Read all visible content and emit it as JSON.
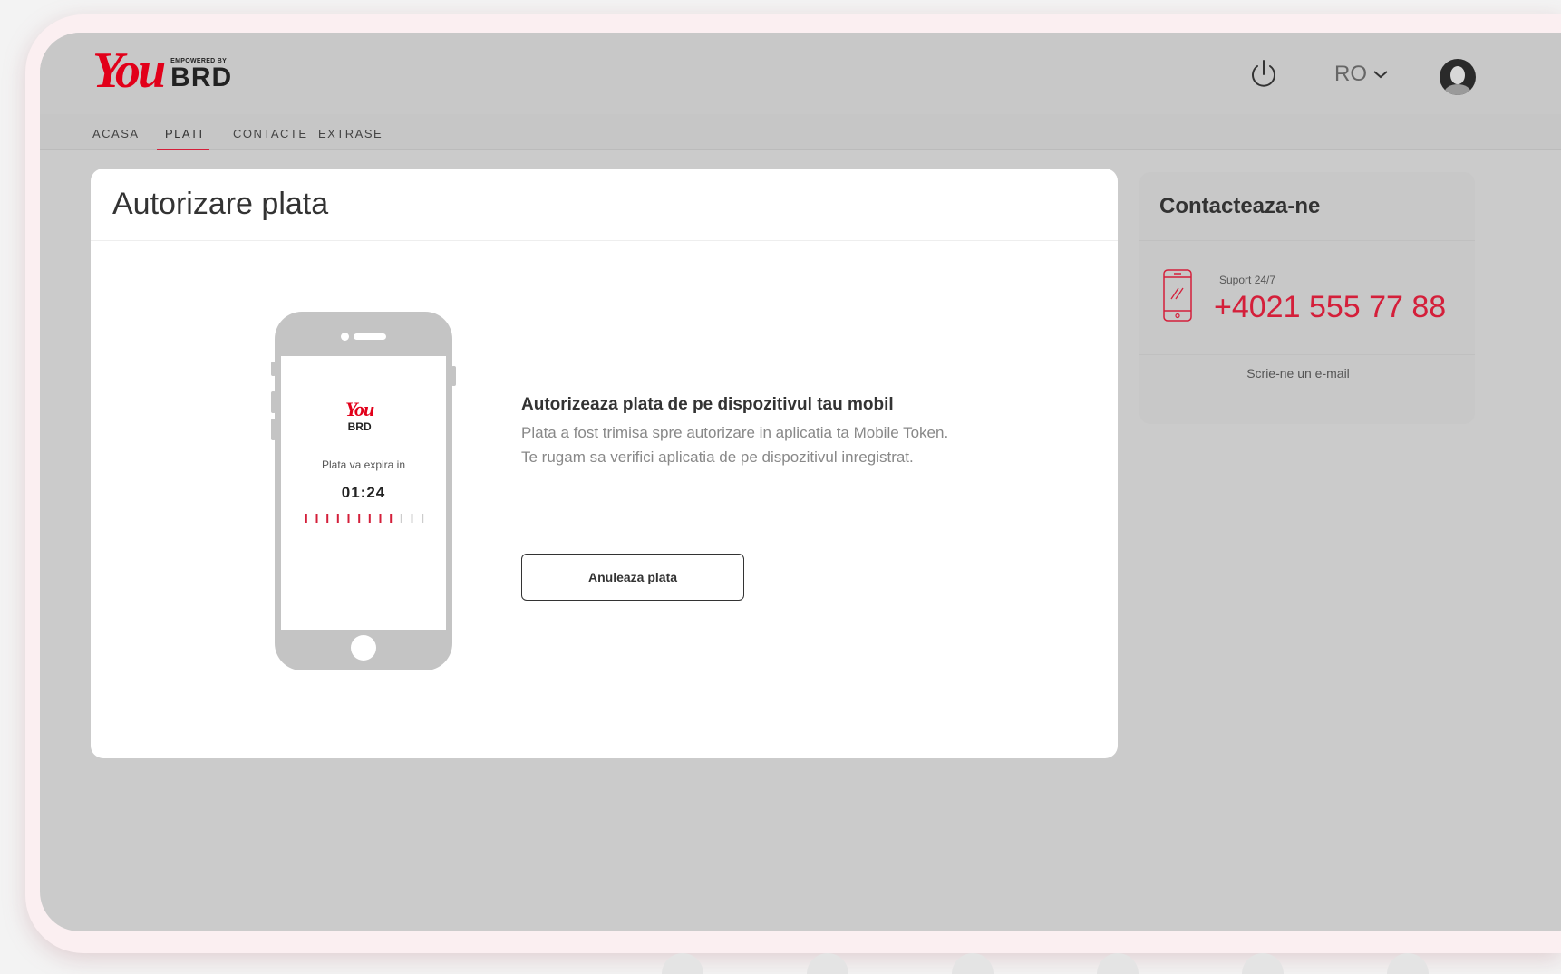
{
  "header": {
    "logo_you": "You",
    "logo_empowered": "EMPOWERED BY",
    "logo_brd": "BRD",
    "language": "RO"
  },
  "nav": {
    "items": [
      {
        "label": "ACASA"
      },
      {
        "label": "PLATI",
        "active": true
      },
      {
        "label": "CONTACTE"
      },
      {
        "label": "EXTRASE"
      }
    ]
  },
  "main": {
    "title": "Autorizare plata",
    "phone_screen": {
      "logo_you": "You",
      "logo_brd": "BRD",
      "expire_label": "Plata va expira in",
      "timer": "01:24",
      "progress_filled_ticks": 9,
      "progress_total_ticks": 12
    },
    "message_title": "Autorizeaza plata de pe dispozitivul tau mobil",
    "message_body": "Plata a fost trimisa spre autorizare in aplicatia ta Mobile Token. Te rugam sa verifici aplicatia de pe dispozitivul inregistrat.",
    "cancel_button": "Anuleaza plata"
  },
  "contact": {
    "title": "Contacteaza-ne",
    "support_label": "Suport 24/7",
    "phone_number": "+4021 555 77 88",
    "email_link": "Scrie-ne un e-mail"
  },
  "colors": {
    "accent": "#d41f3a",
    "brand_red": "#e2001a",
    "overlay_gray": "#cbcbcb"
  },
  "icons": [
    "power-icon",
    "chevron-down-icon",
    "avatar",
    "mobile-phone-icon"
  ]
}
